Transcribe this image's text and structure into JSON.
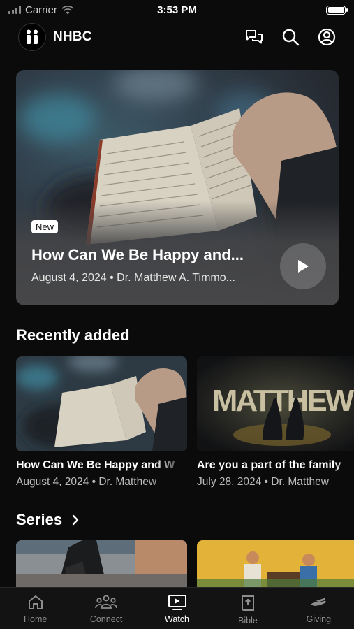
{
  "status_bar": {
    "carrier": "Carrier",
    "time": "3:53 PM",
    "battery_level": 1.0
  },
  "header": {
    "app_name": "NHBC",
    "actions": [
      "chat-icon",
      "search-icon",
      "account-icon"
    ]
  },
  "hero": {
    "badge": "New",
    "title": "How Can We Be Happy and...",
    "meta": "August 4, 2024 • Dr. Matthew A. Timmo..."
  },
  "recently_added": {
    "heading": "Recently added",
    "items": [
      {
        "title": "How Can We Be Happy and W",
        "meta": "August 4, 2024 • Dr. Matthew"
      },
      {
        "title": "Are you a part of the family",
        "meta": "July 28, 2024 • Dr. Matthew"
      }
    ]
  },
  "series": {
    "heading": "Series"
  },
  "tabs": [
    {
      "label": "Home",
      "icon": "home-icon",
      "active": false
    },
    {
      "label": "Connect",
      "icon": "people-icon",
      "active": false
    },
    {
      "label": "Watch",
      "icon": "tv-play-icon",
      "active": true
    },
    {
      "label": "Bible",
      "icon": "bible-icon",
      "active": false
    },
    {
      "label": "Giving",
      "icon": "giving-hand-icon",
      "active": false
    }
  ],
  "colors": {
    "background": "#0b0b0c",
    "tab_inactive": "#8e8e8e",
    "tab_active": "#ffffff"
  }
}
